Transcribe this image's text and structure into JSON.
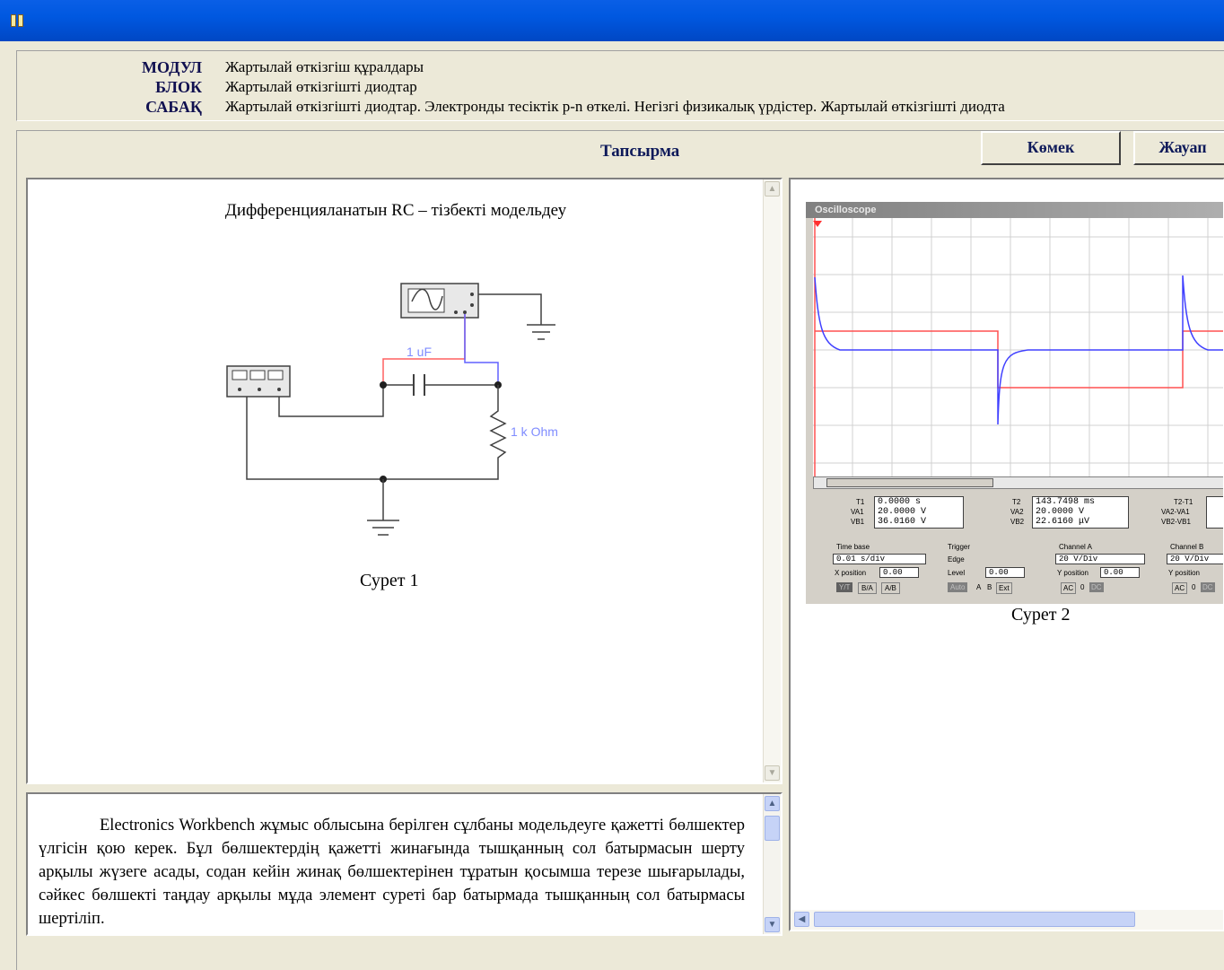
{
  "header": {
    "module_label": "МОДУЛ",
    "module_value": "Жартылай өткізгіш құралдары",
    "block_label": "БЛОК",
    "block_value": "Жартылай өткізгішті диодтар",
    "lesson_label": "САБАҚ",
    "lesson_value": "Жартылай өткізгішті диодтар. Электронды  тесіктік p-n өткелі. Негізгі физикалық үрдістер. Жартылай өткізгішті диодта"
  },
  "toolbar": {
    "task_title": "Тапсырма",
    "help_button": "Көмек",
    "close_button": "Жауап"
  },
  "figure1": {
    "title": "Дифференцияланатын RC – тізбекті модельдеу",
    "capacitor_label": "1 uF",
    "resistor_label": "1 k Ohm",
    "caption": "Сурет 1"
  },
  "figure2": {
    "caption": "Сурет 2",
    "window_title": "Oscilloscope",
    "readouts": {
      "t1_label": "T1",
      "t1_value": "0.0000",
      "t1_unit": "s",
      "va1_label": "VA1",
      "va1_value": "20.0000",
      "va1_unit": "V",
      "vb1_label": "VB1",
      "vb1_value": "36.0160",
      "vb1_unit": "V",
      "t2_label": "T2",
      "t2_value": "143.7498",
      "t2_unit": "ms",
      "va2_label": "VA2",
      "va2_value": "20.0000",
      "va2_unit": "V",
      "vb2_label": "VB2",
      "vb2_value": "22.6160",
      "vb2_unit": "μV",
      "t2t1_label": "T2-T1",
      "va2va1_label": "VA2-VA1",
      "vb2vb1_label": "VB2-VB1"
    },
    "controls": {
      "timebase_label": "Time base",
      "timebase_value": "0.01 s/div",
      "xpos_label": "X position",
      "xpos_value": "0.00",
      "trigger_label": "Trigger",
      "edge_label": "Edge",
      "level_label": "Level",
      "level_value": "0.00",
      "chA_label": "Channel A",
      "chA_value": "20 V/Div",
      "chA_ypos_label": "Y position",
      "chA_ypos_value": "0.00",
      "chB_label": "Channel B",
      "chB_value": "20 V/Div",
      "chB_ypos_label": "Y position",
      "btn_yt": "Y/T",
      "btn_ba": "B/A",
      "btn_ab": "A/B",
      "btn_auto": "Auto",
      "btn_a": "A",
      "btn_b": "B",
      "btn_ext": "Ext",
      "btn_ac": "AC",
      "btn_0": "0",
      "btn_dc": "DC"
    }
  },
  "text_pane": {
    "paragraph": "Electronics Workbench жұмыс облысына берілген сұлбаны модельдеуге қажетті бөлшектер үлгісін қою керек. Бұл бөлшектердің қажетті жинағында тышқанның сол батырмасын шерту арқылы жүзеге асады, содан кейін жинақ бөлшектерінен тұратын қосымша терезе шығарылады, сәйкес бөлшекті таңдау арқылы мұда элемент суреті бар батырмада тышқанның сол батырмасы шертіліп."
  },
  "colors": {
    "titlebar": "#0058e0",
    "window_bg": "#ece9d8",
    "channel_a": "#ff5050",
    "channel_b": "#5050ff"
  }
}
